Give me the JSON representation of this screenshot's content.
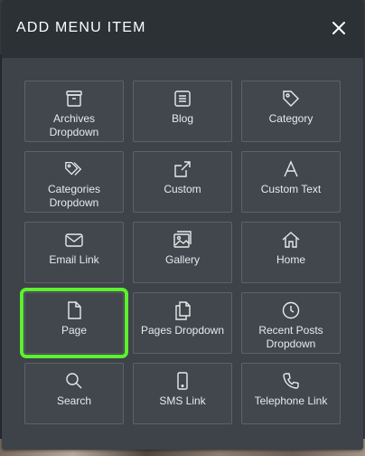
{
  "modal": {
    "title": "ADD MENU ITEM"
  },
  "items": [
    {
      "label": "Archives\nDropdown",
      "icon": "archive-icon"
    },
    {
      "label": "Blog",
      "icon": "list-icon"
    },
    {
      "label": "Category",
      "icon": "tag-icon"
    },
    {
      "label": "Categories\nDropdown",
      "icon": "tags-icon"
    },
    {
      "label": "Custom",
      "icon": "external-link-icon"
    },
    {
      "label": "Custom Text",
      "icon": "letter-a-icon"
    },
    {
      "label": "Email Link",
      "icon": "envelope-icon"
    },
    {
      "label": "Gallery",
      "icon": "images-icon"
    },
    {
      "label": "Home",
      "icon": "home-icon"
    },
    {
      "label": "Page",
      "icon": "document-icon",
      "selected": true
    },
    {
      "label": "Pages Dropdown",
      "icon": "documents-icon"
    },
    {
      "label": "Recent Posts\nDropdown",
      "icon": "clock-icon"
    },
    {
      "label": "Search",
      "icon": "search-icon"
    },
    {
      "label": "SMS Link",
      "icon": "mobile-phone-icon"
    },
    {
      "label": "Telephone Link",
      "icon": "telephone-icon"
    }
  ],
  "colors": {
    "selection_outline": "#5cf02f",
    "modal_bg": "#3d4348",
    "header_bg": "#2c3135"
  }
}
